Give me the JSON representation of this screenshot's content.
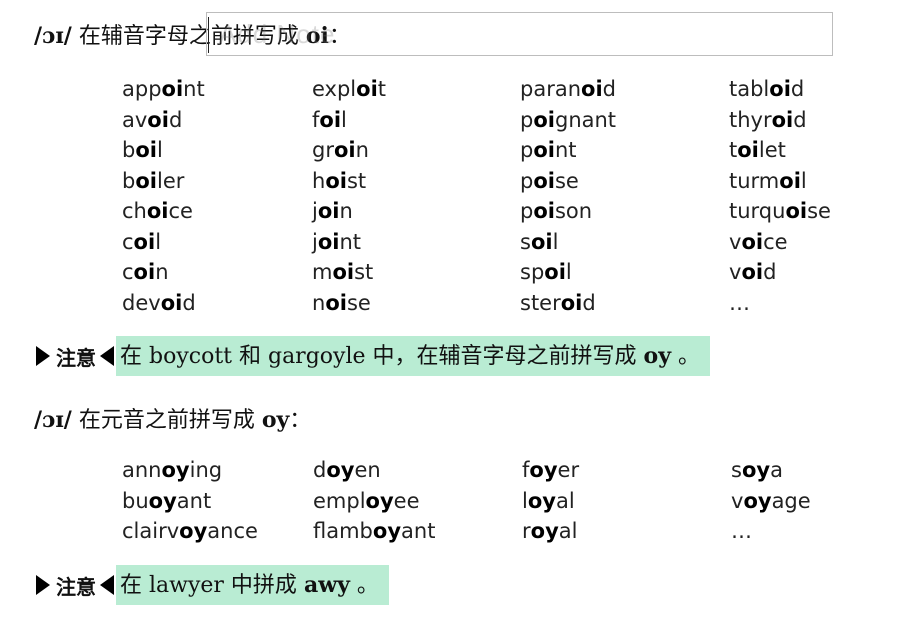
{
  "section1": {
    "ipa": "/ɔɪ/",
    "text": " 在辅音字母之前拼写成 ",
    "spelling": "oi",
    "colon": "：",
    "search_ghost": "Add Note",
    "columns": [
      [
        [
          "app",
          "oi",
          "nt"
        ],
        [
          "av",
          "oi",
          "d"
        ],
        [
          "b",
          "oi",
          "l"
        ],
        [
          "b",
          "oi",
          "ler"
        ],
        [
          "ch",
          "oi",
          "ce"
        ],
        [
          "c",
          "oi",
          "l"
        ],
        [
          "c",
          "oi",
          "n"
        ],
        [
          "dev",
          "oi",
          "d"
        ]
      ],
      [
        [
          "expl",
          "oi",
          "t"
        ],
        [
          "f",
          "oi",
          "l"
        ],
        [
          "gr",
          "oi",
          "n"
        ],
        [
          "h",
          "oi",
          "st"
        ],
        [
          "j",
          "oi",
          "n"
        ],
        [
          "j",
          "oi",
          "nt"
        ],
        [
          "m",
          "oi",
          "st"
        ],
        [
          "n",
          "oi",
          "se"
        ]
      ],
      [
        [
          "paran",
          "oi",
          "d"
        ],
        [
          "p",
          "oi",
          "gnant"
        ],
        [
          "p",
          "oi",
          "nt"
        ],
        [
          "p",
          "oi",
          "se"
        ],
        [
          "p",
          "oi",
          "son"
        ],
        [
          "s",
          "oi",
          "l"
        ],
        [
          "sp",
          "oi",
          "l"
        ],
        [
          "ster",
          "oi",
          "d"
        ]
      ],
      [
        [
          "tabl",
          "oi",
          "d"
        ],
        [
          "thyr",
          "oi",
          "d"
        ],
        [
          "t",
          "oi",
          "let"
        ],
        [
          "turm",
          "oi",
          "l"
        ],
        [
          "turqu",
          "oi",
          "se"
        ],
        [
          "v",
          "oi",
          "ce"
        ],
        [
          "v",
          "oi",
          "d"
        ],
        [
          "…",
          "",
          ""
        ]
      ]
    ]
  },
  "note1": {
    "label": "注意",
    "text_before": "在 boycott 和 gargoyle 中，在辅音字母之前拼写成 ",
    "bold": "oy",
    "text_after": " 。"
  },
  "section2": {
    "ipa": "/ɔɪ/",
    "text": " 在元音之前拼写成 ",
    "spelling": "oy",
    "colon": "：",
    "columns": [
      [
        [
          "ann",
          "oy",
          "ing"
        ],
        [
          "bu",
          "oy",
          "ant"
        ],
        [
          "clairv",
          "oy",
          "ance"
        ]
      ],
      [
        [
          "d",
          "oy",
          "en"
        ],
        [
          "empl",
          "oy",
          "ee"
        ],
        [
          "flamb",
          "oy",
          "ant"
        ]
      ],
      [
        [
          "f",
          "oy",
          "er"
        ],
        [
          "l",
          "oy",
          "al"
        ],
        [
          "r",
          "oy",
          "al"
        ]
      ],
      [
        [
          "s",
          "oy",
          "a"
        ],
        [
          "v",
          "oy",
          "age"
        ],
        [
          "…",
          "",
          ""
        ]
      ]
    ]
  },
  "note2": {
    "label": "注意",
    "text_before": "在 lawyer 中拼成 ",
    "bold": "awy",
    "text_after": " 。"
  }
}
